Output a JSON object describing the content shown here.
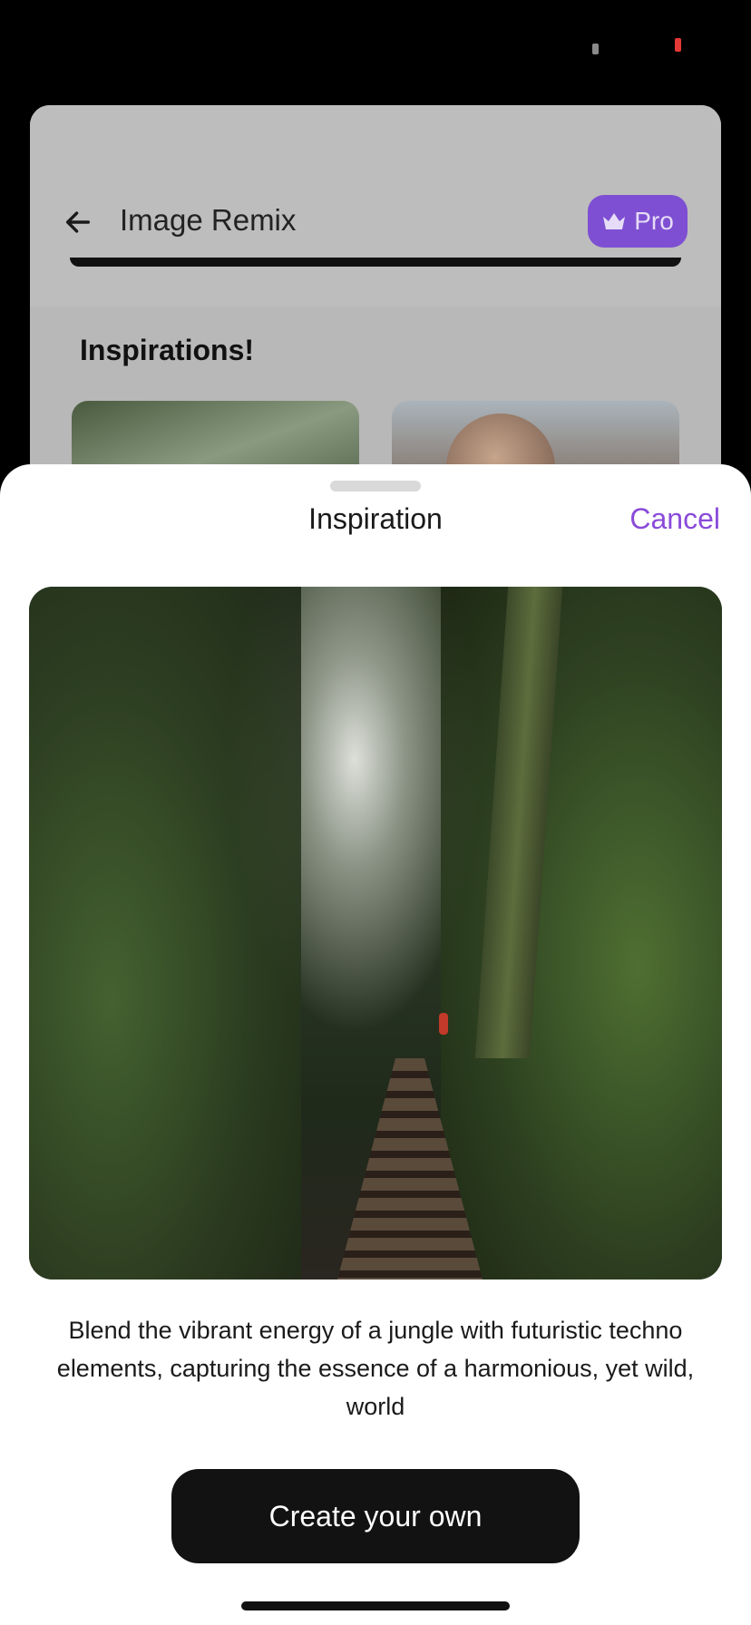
{
  "background_screen": {
    "title": "Image Remix",
    "pro_label": "Pro",
    "section_title": "Inspirations!",
    "icons": {
      "back": "arrow-left-icon",
      "pro": "crown-icon"
    }
  },
  "sheet": {
    "title": "Inspiration",
    "cancel_label": "Cancel",
    "description": "Blend the vibrant energy of a jungle with futuristic techno elements, capturing the essence of a harmonious, yet wild, world",
    "create_label": "Create your own"
  },
  "colors": {
    "accent": "#8A4BD9",
    "pro_background": "#7E4FD2",
    "primary_button": "#121212"
  }
}
